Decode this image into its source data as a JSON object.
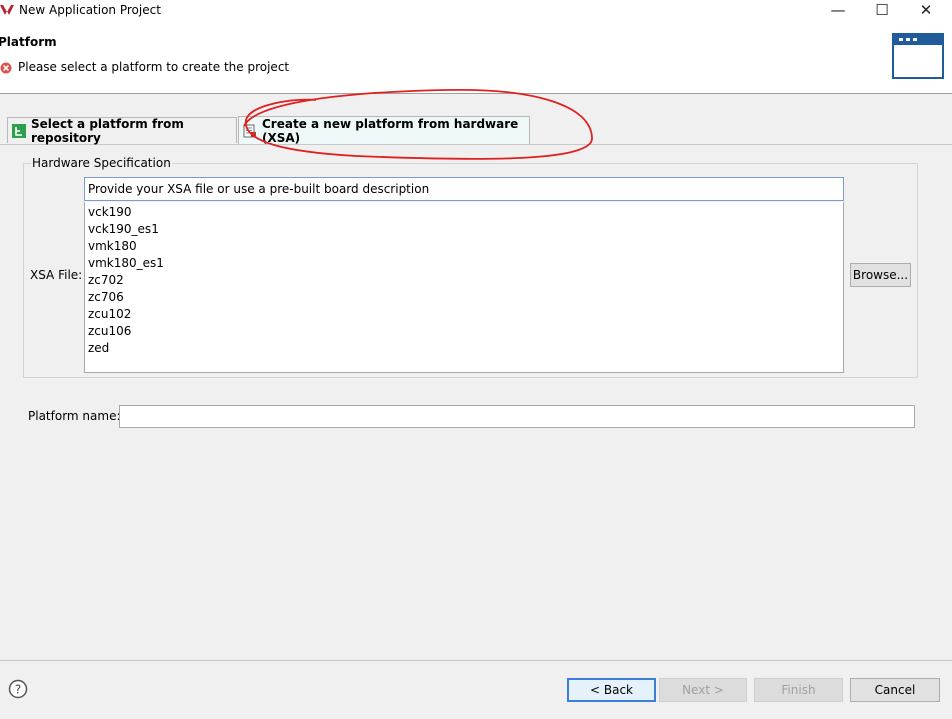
{
  "window": {
    "title": "New Application Project",
    "minimize": "—",
    "maximize": "☐",
    "close": "✕"
  },
  "header": {
    "title": "Platform",
    "error_message": "Please select a platform to create the project"
  },
  "tabs": [
    {
      "label": "Select a platform from repository",
      "icon": "platform-repo-icon"
    },
    {
      "label": "Create a new platform from hardware (XSA)",
      "icon": "hardware-xsa-icon"
    }
  ],
  "hardware_spec": {
    "group_title": "Hardware Specification",
    "xsa_label": "XSA File:",
    "xsa_placeholder": "Provide your XSA file or use a pre-built board description",
    "boards": [
      "vck190",
      "vck190_es1",
      "vmk180",
      "vmk180_es1",
      "zc702",
      "zc706",
      "zcu102",
      "zcu106",
      "zed"
    ],
    "browse_label": "Browse..."
  },
  "platform": {
    "name_label": "Platform name:",
    "name_value": ""
  },
  "footer": {
    "help": "?",
    "back_label": "< Back",
    "next_label": "Next >",
    "finish_label": "Finish",
    "cancel_label": "Cancel"
  },
  "colors": {
    "accent": "#3c7fd6",
    "error": "#d9534f",
    "annotation": "#e02020",
    "wizard_icon": "#1f5c99"
  }
}
